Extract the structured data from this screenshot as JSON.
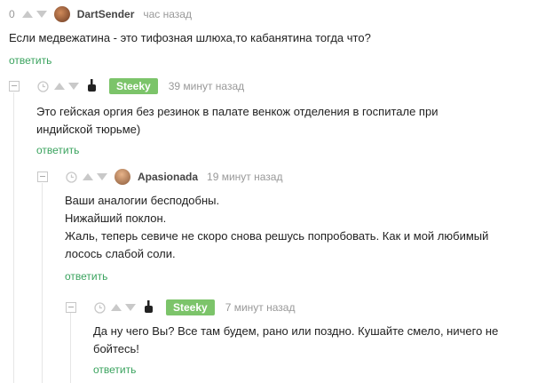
{
  "comments": [
    {
      "rating": "0",
      "user": "DartSender",
      "time": "час назад",
      "text_lines": [
        "Если медвежатина - это тифозная шлюха,то кабанятина тогда что?"
      ],
      "reply": "ответить"
    },
    {
      "user": "Steeky",
      "time": "39 минут назад",
      "text_lines": [
        "Это гейская оргия без резинок в палате венкож отделения в госпитале при",
        "индийской тюрьме)"
      ],
      "reply": "ответить"
    },
    {
      "user": "Apasionada",
      "time": "19 минут назад",
      "text_lines": [
        "Ваши аналогии бесподобны.",
        "Нижайший поклон.",
        "Жаль, теперь севиче не скоро снова решусь попробовать. Как и мой любимый",
        "лосось слабой соли."
      ],
      "reply": "ответить"
    },
    {
      "user": "Steeky",
      "time": "7 минут назад",
      "text_lines": [
        "Да ну чего Вы? Все там будем, рано или поздно. Кушайте смело, ничего не",
        "бойтесь!"
      ],
      "reply": "ответить"
    }
  ],
  "colors": {
    "accent_green": "#7cc46a",
    "reply_green": "#3aa35e",
    "muted": "#999999"
  },
  "icons": {
    "clock": "clock-icon",
    "up": "upvote-arrow-icon",
    "down": "downvote-arrow-icon",
    "finger": "middle-finger-icon",
    "collapse": "collapse-minus-icon"
  }
}
